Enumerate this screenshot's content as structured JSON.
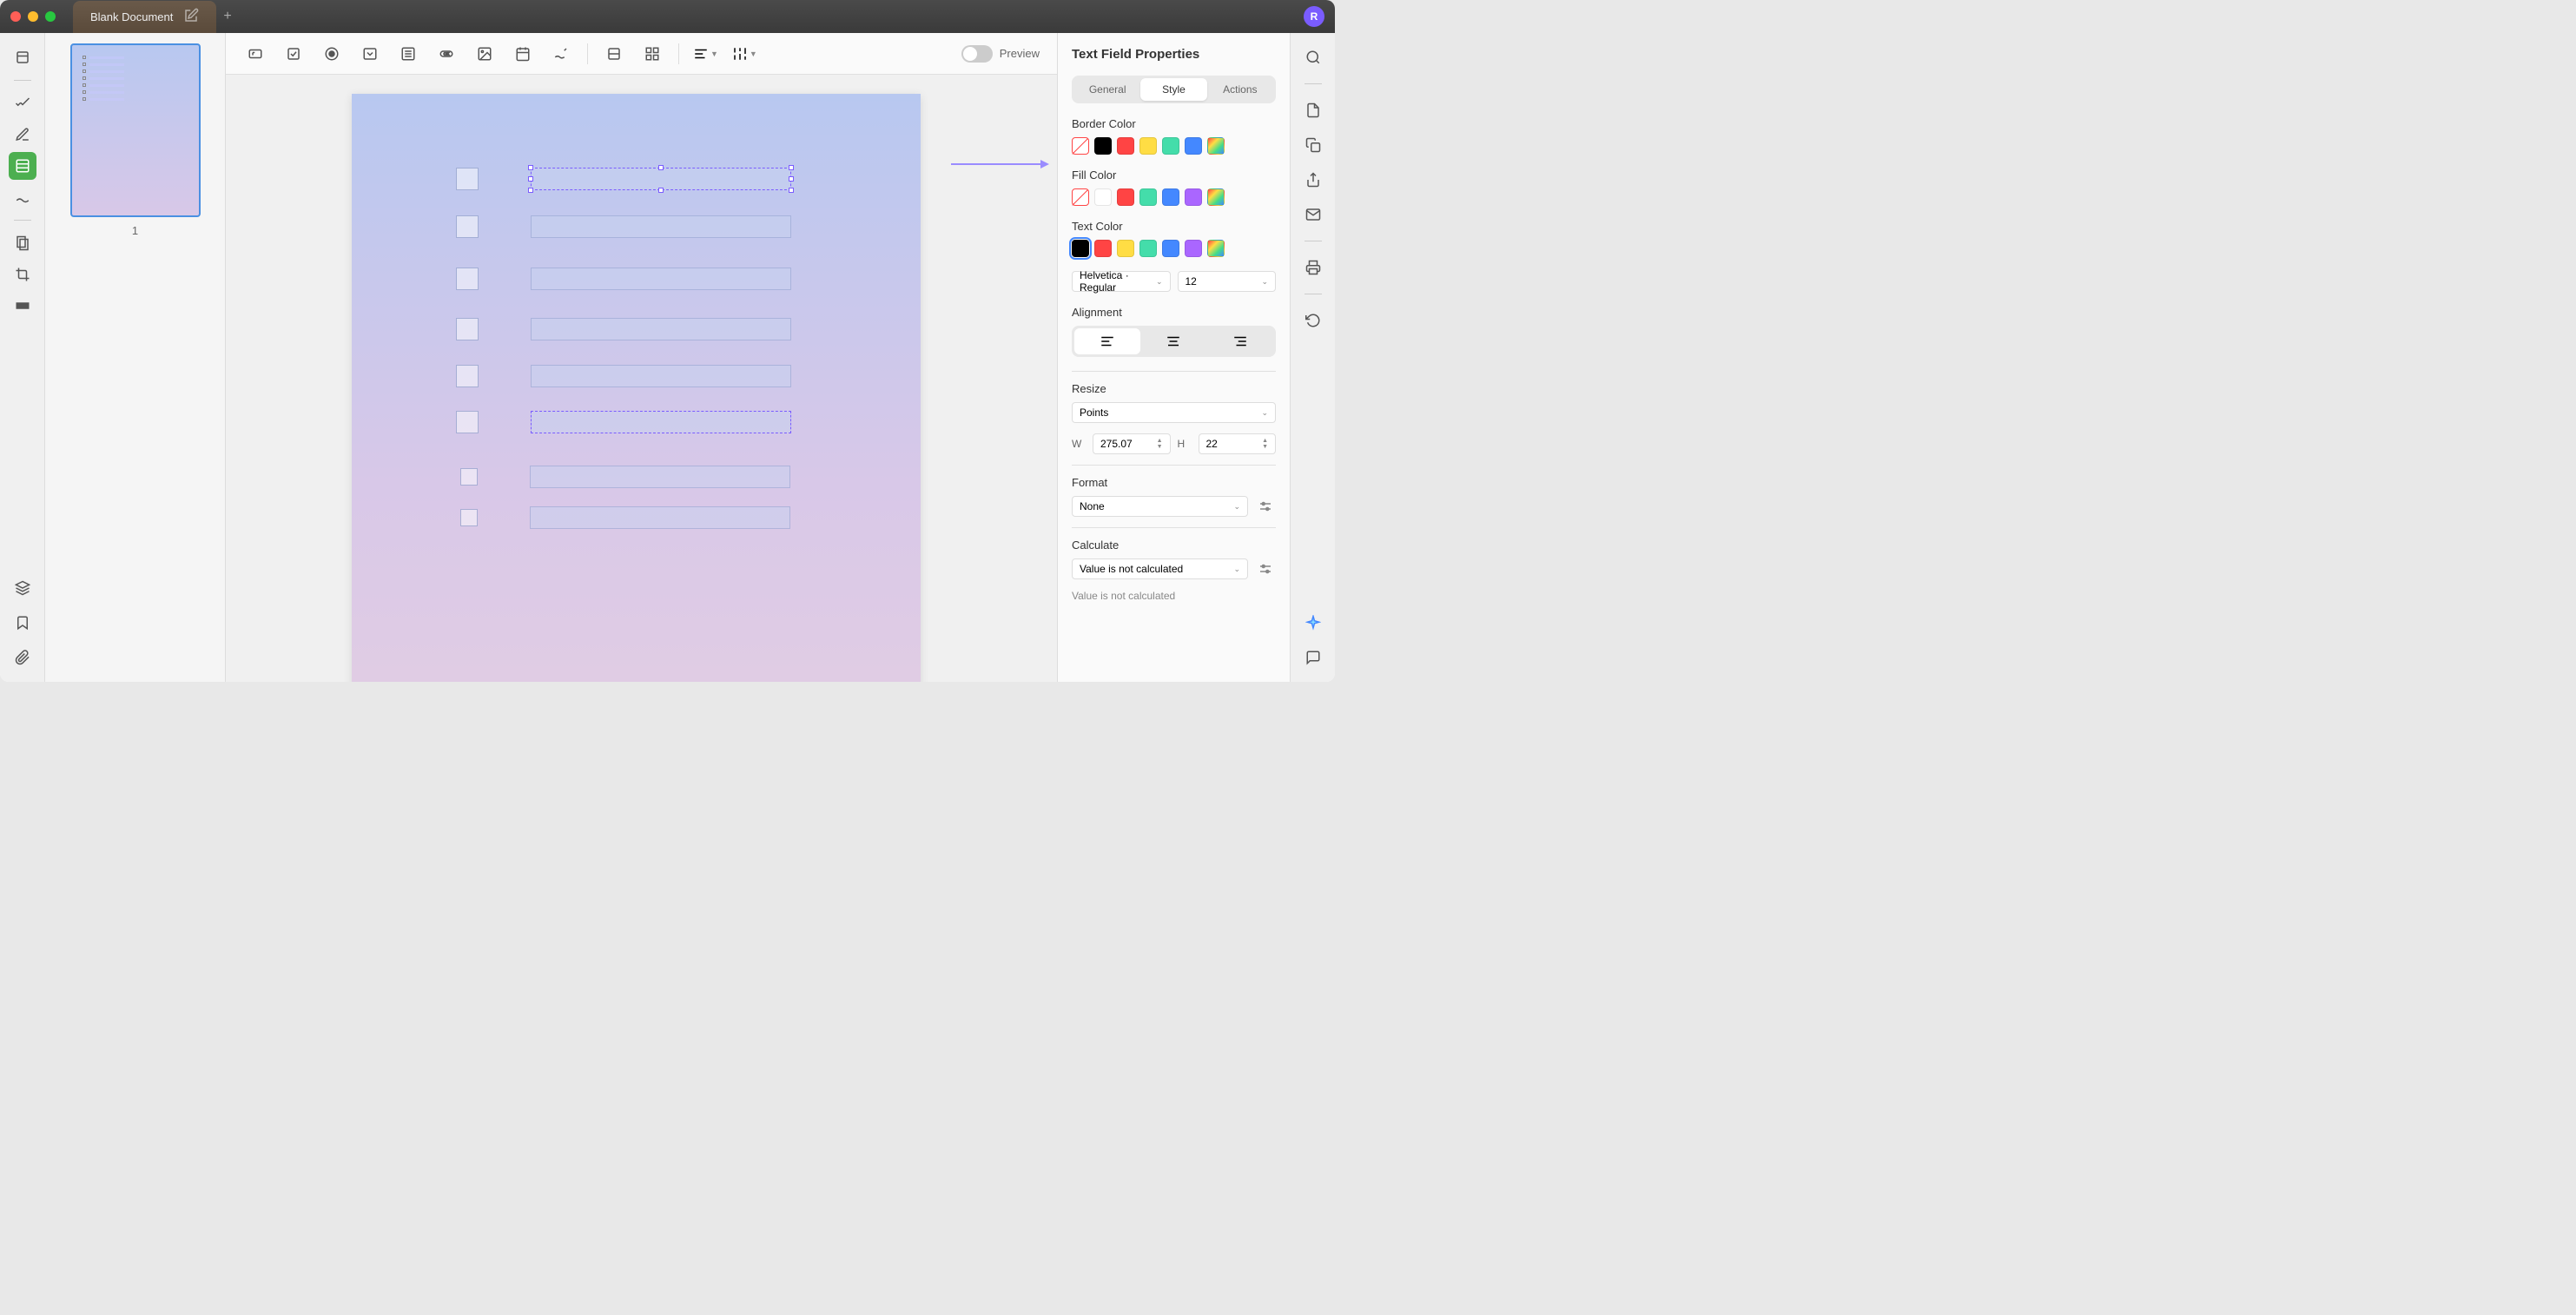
{
  "tab_title": "Blank Document",
  "user_initial": "R",
  "thumbnail_number": "1",
  "preview_label": "Preview",
  "properties_title": "Text Field Properties",
  "tabs": {
    "general": "General",
    "style": "Style",
    "actions": "Actions"
  },
  "sections": {
    "border_color": "Border Color",
    "fill_color": "Fill Color",
    "text_color": "Text Color",
    "alignment": "Alignment",
    "resize": "Resize",
    "format": "Format",
    "calculate": "Calculate"
  },
  "border_colors": [
    "none",
    "#000000",
    "#ff4444",
    "#ffdd44",
    "#44ddaa",
    "#4488ff",
    "#88dd44"
  ],
  "fill_colors": [
    "none",
    "#ffffff",
    "#ff4444",
    "#44ddaa",
    "#4488ff",
    "#aa66ff",
    "#88dd44"
  ],
  "text_colors": [
    "#000000",
    "#ff4444",
    "#ffdd44",
    "#44ddaa",
    "#4488ff",
    "#aa66ff",
    "#88dd44"
  ],
  "text_color_selected": 0,
  "font_name": "Helvetica · Regular",
  "font_size": "12",
  "resize_unit": "Points",
  "width_label": "W",
  "width_value": "275.07",
  "height_label": "H",
  "height_value": "22",
  "format_value": "None",
  "calculate_value": "Value is not calculated",
  "calculate_description": "Value is not calculated",
  "multi_color_gradient": "linear-gradient(135deg, #ff4444, #ffdd44, #44dd88, #4488ff)"
}
